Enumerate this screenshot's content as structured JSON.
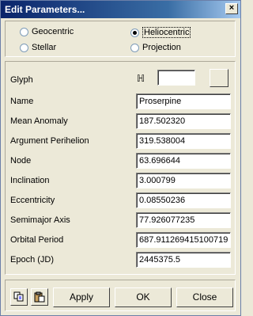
{
  "window": {
    "title": "Edit Parameters...",
    "close_glyph": "×"
  },
  "coordinates": {
    "options": [
      {
        "label": "Geocentric",
        "selected": false
      },
      {
        "label": "Heliocentric",
        "selected": true
      },
      {
        "label": "Stellar",
        "selected": false
      },
      {
        "label": "Projection",
        "selected": false
      }
    ]
  },
  "params": {
    "glyph": {
      "label": "Glyph",
      "symbol": "ℍ",
      "value": ""
    },
    "fields": [
      {
        "label": "Name",
        "value": "Proserpine"
      },
      {
        "label": "Mean Anomaly",
        "value": "187.502320"
      },
      {
        "label": "Argument Perihelion",
        "value": "319.538004"
      },
      {
        "label": "Node",
        "value": "63.696644"
      },
      {
        "label": "Inclination",
        "value": "3.000799"
      },
      {
        "label": "Eccentricity",
        "value": "0.08550236"
      },
      {
        "label": "Semimajor Axis",
        "value": "77.926077235"
      },
      {
        "label": "Orbital Period",
        "value": "687.911269415100719"
      },
      {
        "label": "Epoch (JD)",
        "value": "2445375.5"
      }
    ]
  },
  "buttons": {
    "apply": "Apply",
    "ok": "OK",
    "close": "Close"
  },
  "icons": {
    "copy": "copy-icon",
    "paste": "paste-icon"
  }
}
